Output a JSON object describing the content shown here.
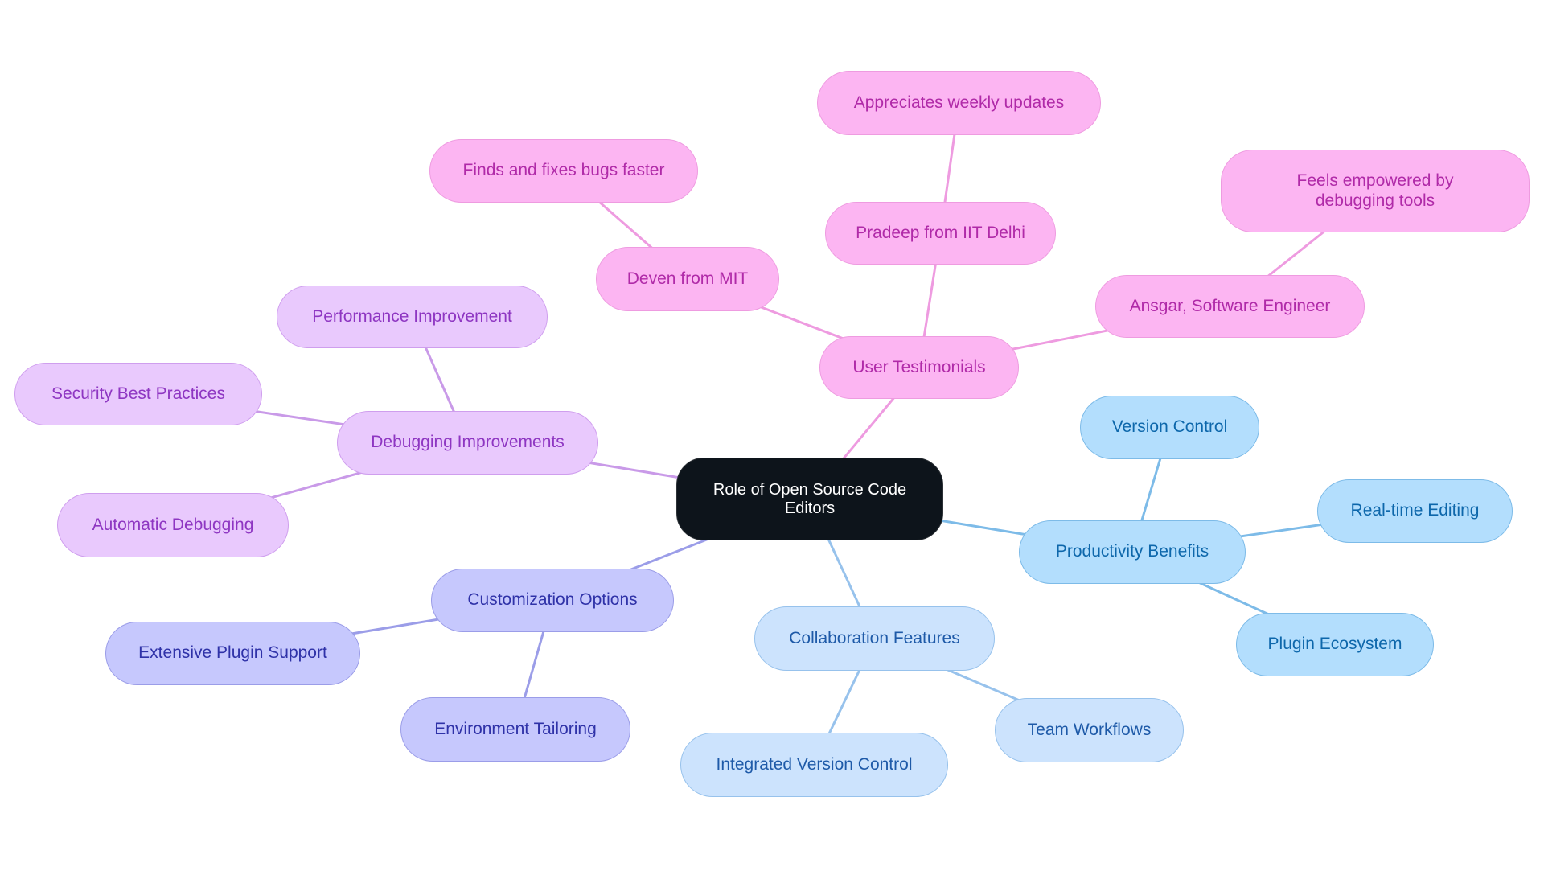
{
  "title": "Role of Open Source Code Editors",
  "colors": {
    "root_bg": "#0d141b",
    "testimonials": "#fcb5f2",
    "debugging": "#e9c9fd",
    "customization": "#c6c8fd",
    "productivity": "#b3defd",
    "collaboration": "#cce3fd",
    "edge_testimonials": "#ee9be0",
    "edge_debugging": "#c99ae8",
    "edge_customization": "#9b9de8",
    "edge_productivity": "#7dbbe8",
    "edge_collaboration": "#97c2ec"
  },
  "nodes": {
    "root": "Role of Open Source Code Editors",
    "user_testimonials": "User Testimonials",
    "appreciates": "Appreciates weekly updates",
    "pradeep": "Pradeep from IIT Delhi",
    "finds": "Finds and fixes bugs faster",
    "deven": "Deven from MIT",
    "feels": "Feels empowered by debugging tools",
    "ansgar": "Ansgar, Software Engineer",
    "debugging": "Debugging Improvements",
    "performance": "Performance Improvement",
    "security": "Security Best Practices",
    "automatic": "Automatic Debugging",
    "customization": "Customization Options",
    "extensive": "Extensive Plugin Support",
    "environment": "Environment Tailoring",
    "collaboration": "Collaboration Features",
    "integrated": "Integrated Version Control",
    "team": "Team Workflows",
    "productivity": "Productivity Benefits",
    "version_control": "Version Control",
    "realtime": "Real-time Editing",
    "plugin": "Plugin Ecosystem"
  },
  "edges": [
    [
      "root",
      "user_testimonials",
      "testimonials"
    ],
    [
      "user_testimonials",
      "deven",
      "testimonials"
    ],
    [
      "deven",
      "finds",
      "testimonials"
    ],
    [
      "user_testimonials",
      "pradeep",
      "testimonials"
    ],
    [
      "pradeep",
      "appreciates",
      "testimonials"
    ],
    [
      "user_testimonials",
      "ansgar",
      "testimonials"
    ],
    [
      "ansgar",
      "feels",
      "testimonials"
    ],
    [
      "root",
      "debugging",
      "debugging"
    ],
    [
      "debugging",
      "performance",
      "debugging"
    ],
    [
      "debugging",
      "security",
      "debugging"
    ],
    [
      "debugging",
      "automatic",
      "debugging"
    ],
    [
      "root",
      "customization",
      "customization"
    ],
    [
      "customization",
      "extensive",
      "customization"
    ],
    [
      "customization",
      "environment",
      "customization"
    ],
    [
      "root",
      "collaboration",
      "collaboration"
    ],
    [
      "collaboration",
      "integrated",
      "collaboration"
    ],
    [
      "collaboration",
      "team",
      "collaboration"
    ],
    [
      "root",
      "productivity",
      "productivity"
    ],
    [
      "productivity",
      "version_control",
      "productivity"
    ],
    [
      "productivity",
      "realtime",
      "productivity"
    ],
    [
      "productivity",
      "plugin",
      "productivity"
    ]
  ]
}
